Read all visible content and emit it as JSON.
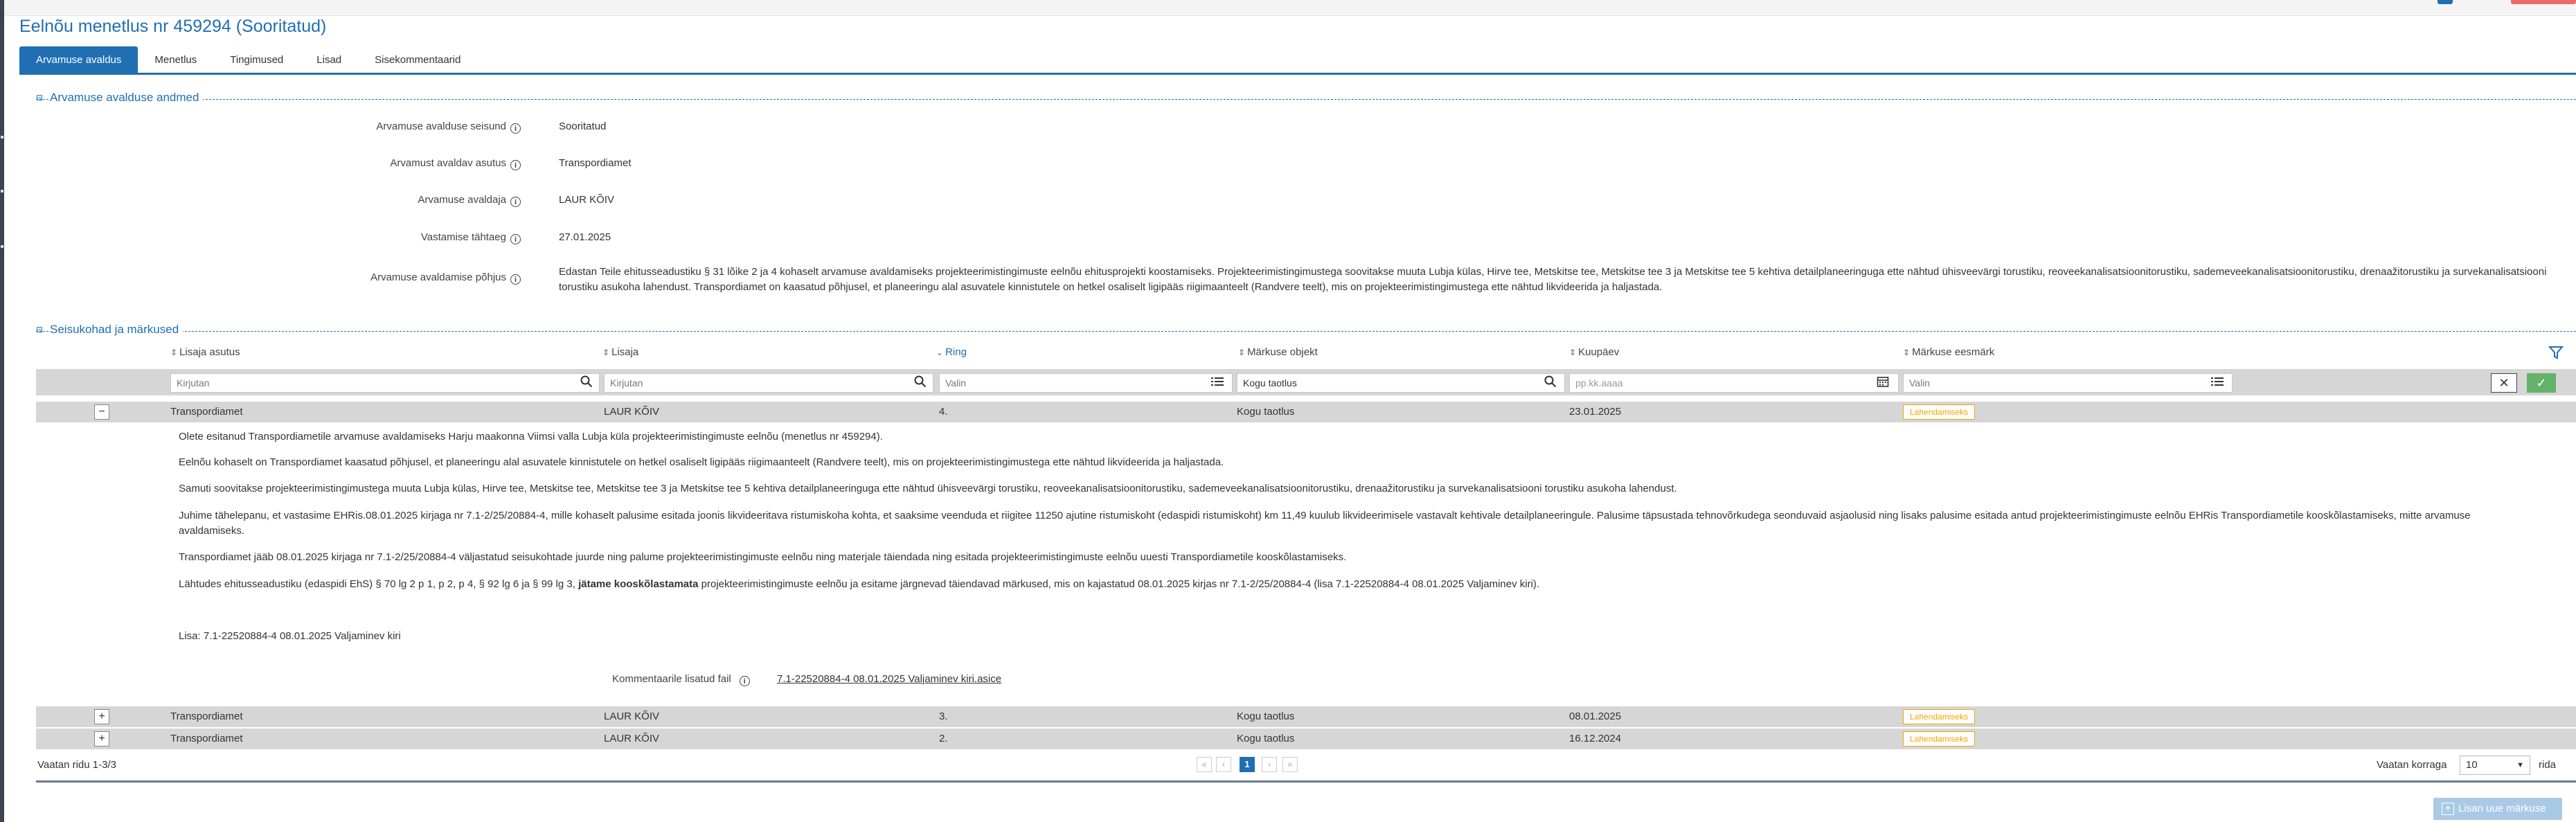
{
  "page": {
    "title": "Eelnõu menetlus nr 459294 (Sooritatud)",
    "accent": "#1f6fb2"
  },
  "tabs": [
    {
      "label": "Arvamuse avaldus",
      "active": true
    },
    {
      "label": "Menetlus"
    },
    {
      "label": "Tingimused"
    },
    {
      "label": "Lisad"
    },
    {
      "label": "Sisekommentaarid"
    }
  ],
  "details": {
    "section_title": "Arvamuse avalduse andmed",
    "rows": [
      {
        "label": "Arvamuse avalduse seisund",
        "value": "Sooritatud"
      },
      {
        "label": "Arvamust avaldav asutus",
        "value": "Transpordiamet"
      },
      {
        "label": "Arvamuse avaldaja",
        "value": "LAUR KÕIV"
      },
      {
        "label": "Vastamise tähtaeg",
        "value": "27.01.2025"
      },
      {
        "label": "Arvamuse avaldamise põhjus",
        "value": "Edastan Teile ehitusseadustiku § 31 lõike 2 ja 4 kohaselt arvamuse avaldamiseks projekteerimistingimuste eelnõu ehitusprojekti koostamiseks. Projekteerimistingimustega soovitakse muuta Lubja külas, Hirve tee, Metskitse tee, Metskitse tee 3 ja Metskitse tee 5 kehtiva detailplaneeringuga ette nähtud ühisveevärgi torustiku, reoveekanalisatsioonitorustiku, sademeveekanalisatsioonitorustiku, drenaažitorustiku ja survekanalisatsiooni torustiku asukoha lahendust. Transpordiamet on kaasatud põhjusel, et planeeringu alal asuvatele kinnistutele on hetkel osaliselt ligipääs riigimaanteelt (Randvere teelt), mis on projekteerimistingimustega ette nähtud likvideerida ja haljastada."
      }
    ]
  },
  "remarks": {
    "section_title": "Seisukohad ja märkused",
    "columns": [
      "Lisaja asutus",
      "Lisaja",
      "Ring",
      "Märkuse objekt",
      "Kuupäev",
      "Märkuse eesmärk"
    ],
    "filters": {
      "asutus": "Kirjutan",
      "lisaja": "Kirjutan",
      "ring": "Valin",
      "objekt": "Kogu taotlus",
      "kuupaev": "pp.kk.aaaa",
      "eesmark": "Valin"
    },
    "rows": [
      {
        "asutus": "Transpordiamet",
        "lisaja": "LAUR KÕIV",
        "ring": "4.",
        "objekt": "Kogu taotlus",
        "kuupaev": "23.01.2025",
        "eesmark": "Lahendamiseks",
        "expanded": true
      },
      {
        "asutus": "Transpordiamet",
        "lisaja": "LAUR KÕIV",
        "ring": "3.",
        "objekt": "Kogu taotlus",
        "kuupaev": "08.01.2025",
        "eesmark": "Lahendamiseks",
        "expanded": false
      },
      {
        "asutus": "Transpordiamet",
        "lisaja": "LAUR KÕIV",
        "ring": "2.",
        "objekt": "Kogu taotlus",
        "kuupaev": "16.12.2024",
        "eesmark": "Lahendamiseks",
        "expanded": false
      }
    ],
    "expanded_text": {
      "p1": "Olete esitanud Transpordiametile arvamuse avaldamiseks Harju maakonna Viimsi valla Lubja küla projekteerimistingimuste eelnõu (menetlus nr 459294).",
      "p2": "Eelnõu kohaselt on Transpordiamet kaasatud põhjusel, et planeeringu alal asuvatele kinnistutele on hetkel osaliselt ligipääs riigimaanteelt (Randvere teelt), mis on projekteerimistingimustega ette nähtud likvideerida ja haljastada.",
      "p3": "Samuti soovitakse projekteerimistingimustega muuta Lubja külas, Hirve tee, Metskitse tee, Metskitse tee 3 ja Metskitse tee 5 kehtiva detailplaneeringuga ette nähtud ühisveevärgi torustiku, reoveekanalisatsioonitorustiku, sademeveekanalisatsioonitorustiku, drenaažitorustiku ja survekanalisatsiooni torustiku asukoha lahendust.",
      "p4": "Juhime tähelepanu, et vastasime EHRis.08.01.2025 kirjaga nr 7.1-2/25/20884-4, mille kohaselt palusime esitada joonis likvideeritava ristumiskoha kohta, et saaksime veenduda et riigitee 11250 ajutine ristumiskoht (edaspidi ristumiskoht) km 11,49 kuulub likvideerimisele vastavalt kehtivale detailplaneeringule. Palusime täpsustada tehnovõrkudega seonduvaid asjaolusid ning lisaks palusime esitada antud projekteerimistingimuste eelnõu EHRis Transpordiametile kooskõlastamiseks, mitte arvamuse avaldamiseks.",
      "p5": "Transpordiamet jääb 08.01.2025 kirjaga nr 7.1-2/25/20884-4 väljastatud seisukohtade juurde ning palume projekteerimistingimuste eelnõu ning materjale täiendada ning esitada projekteerimistingimuste eelnõu uuesti Transpordiametile kooskõlastamiseks.",
      "p6_before": "Lähtudes ehitusseadustiku (edaspidi EhS) § 70 lg 2 p 1, p 2, p 4, § 92 lg 6 ja § 99 lg 3, ",
      "p6_bold": "jätame kooskõlastamata",
      "p6_after": " projekteerimistingimuste eelnõu ja esitame järgnevad täiendavad märkused, mis on kajastatud 08.01.2025 kirjas nr 7.1-2/25/20884-4 (lisa 7.1-22520884-4 08.01.2025 Valjaminev kiri).",
      "p7": "Lisa: 7.1-22520884-4 08.01.2025 Valjaminev kiri",
      "file_label": "Kommentaarile lisatud fail",
      "file_name": "7.1-22520884-4 08.01.2025 Valjaminev kiri.asice"
    },
    "footer": {
      "rows_info": "Vaatan ridu 1-3/3",
      "page": "1",
      "per_page_label": "Vaatan korraga",
      "per_page_value": "10",
      "rows_suffix": "rida",
      "add_button": "Lisan uue märkuse"
    }
  },
  "colors": {
    "badge": "#f0a500",
    "row_bg": "#d6d6d6",
    "ok_button": "#63b36a"
  }
}
